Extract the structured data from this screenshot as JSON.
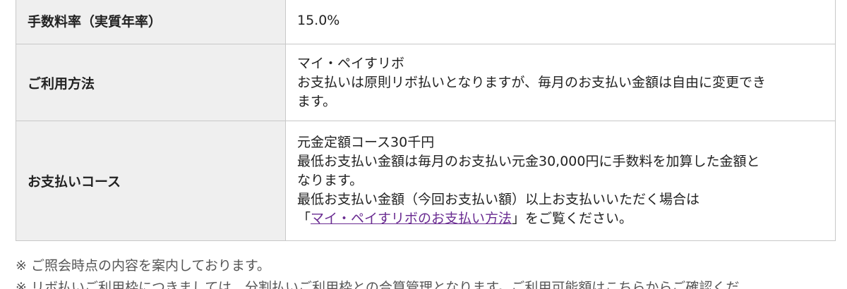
{
  "table": {
    "rows": [
      {
        "label": "手数料率（実質年率）",
        "lines": [
          "15.0%"
        ]
      },
      {
        "label": "ご利用方法",
        "lines": [
          "マイ・ペイすリボ",
          "お支払いは原則リボ払いとなりますが、毎月のお支払い金額は自由に変更でき",
          "ます。"
        ]
      },
      {
        "label": "お支払いコース",
        "lines": [
          "元金定額コース30千円",
          "最低お支払い金額は毎月のお支払い元金30,000円に手数料を加算した金額と",
          "なります。",
          "最低お支払い金額（今回お支払い額）以上お支払いいただく場合は"
        ],
        "link_prefix": "「",
        "link_text": "マイ・ペイすリボのお支払い方法",
        "link_suffix": "」をご覧ください。"
      }
    ]
  },
  "notes": [
    "※ ご照会時点の内容を案内しております。",
    "※ リボ払いご利用枠につきましては、分割払いご利用枠との合算管理となります。ご利用可能額はこちらからご確認くだ"
  ],
  "colors": {
    "header_bg": "#efefef",
    "border": "#c8c8c8",
    "link": "#6a2c91",
    "note_text": "#555555"
  }
}
